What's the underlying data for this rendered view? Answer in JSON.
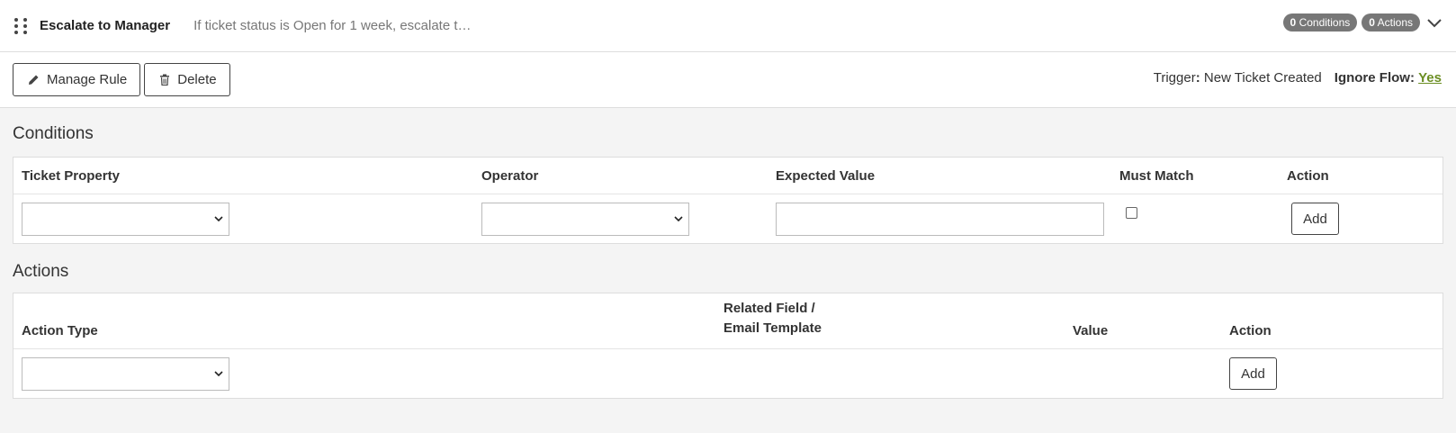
{
  "rule": {
    "name": "Escalate to Manager",
    "description": "If ticket status is Open for 1 week, escalate t…",
    "conditions_count": "0",
    "conditions_label": "Conditions",
    "actions_count": "0",
    "actions_label": "Actions"
  },
  "toolbar": {
    "manage_label": "Manage Rule",
    "delete_label": "Delete",
    "trigger_label": "Trigger",
    "trigger_value": "New Ticket Created",
    "ignore_label": "Ignore Flow:",
    "ignore_value": "Yes"
  },
  "conditions": {
    "title": "Conditions",
    "columns": [
      "Ticket Property",
      "Operator",
      "Expected Value",
      "Must Match",
      "Action"
    ],
    "add_label": "Add"
  },
  "actions": {
    "title": "Actions",
    "columns": [
      "Action Type",
      "Related Field /",
      "Email Template",
      "Value",
      "Action"
    ],
    "add_label": "Add"
  },
  "colors": {
    "link_green": "#6b8e23",
    "badge_gray": "#777777"
  },
  "icons": {
    "drag": "drag-handle-icon",
    "chevron": "chevron-down-icon",
    "edit": "pencil-icon",
    "delete": "trash-icon"
  }
}
